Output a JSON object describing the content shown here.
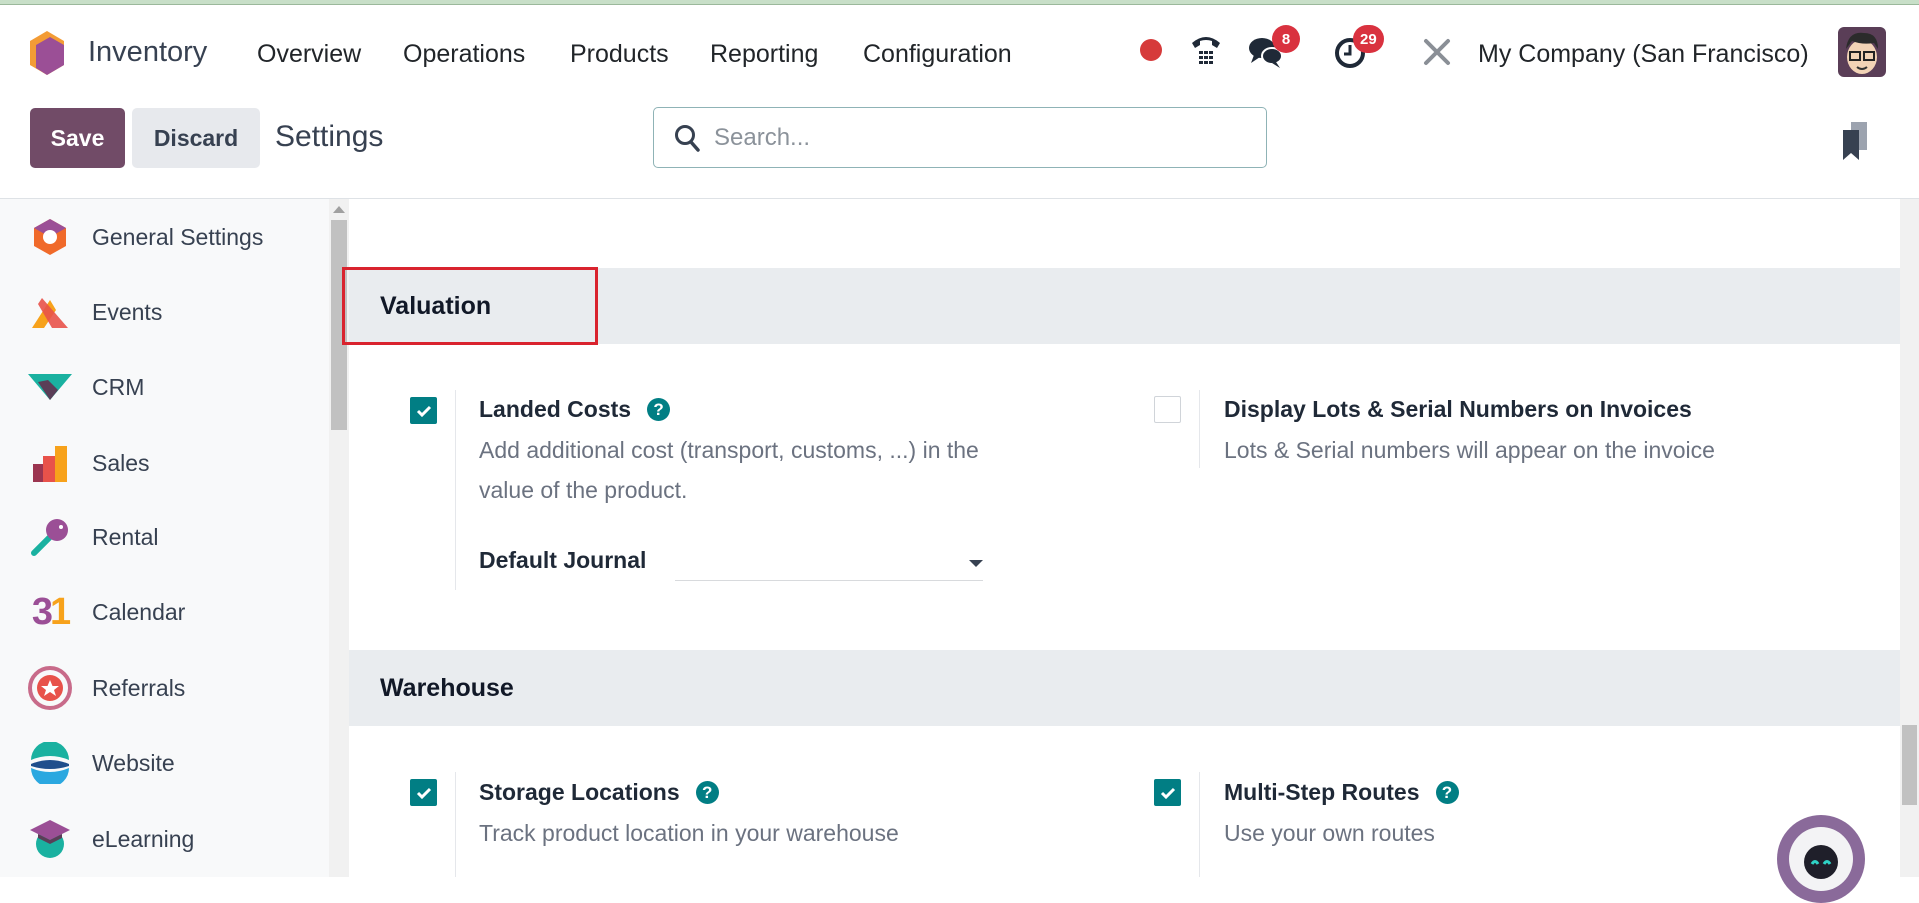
{
  "navbar": {
    "app_name": "Inventory",
    "menu": [
      "Overview",
      "Operations",
      "Products",
      "Reporting",
      "Configuration"
    ],
    "messages_count": "8",
    "activities_count": "29",
    "company": "My Company (San Francisco)"
  },
  "control": {
    "save_label": "Save",
    "discard_label": "Discard",
    "title": "Settings",
    "search_placeholder": "Search..."
  },
  "sidebar": {
    "items": [
      {
        "label": "General Settings",
        "icon": "general-settings-icon"
      },
      {
        "label": "Events",
        "icon": "events-icon"
      },
      {
        "label": "CRM",
        "icon": "crm-icon"
      },
      {
        "label": "Sales",
        "icon": "sales-icon"
      },
      {
        "label": "Rental",
        "icon": "rental-icon"
      },
      {
        "label": "Calendar",
        "icon": "calendar-icon",
        "glyph": "31"
      },
      {
        "label": "Referrals",
        "icon": "referrals-icon"
      },
      {
        "label": "Website",
        "icon": "website-icon"
      },
      {
        "label": "eLearning",
        "icon": "elearning-icon"
      }
    ]
  },
  "sections": {
    "valuation": {
      "title": "Valuation",
      "landed_costs": {
        "title": "Landed Costs",
        "checked": true,
        "desc1": "Add additional cost (transport, customs, ...) in the",
        "desc2": "value of the product.",
        "journal_label": "Default Journal",
        "journal_value": ""
      },
      "lots_invoices": {
        "title": "Display Lots & Serial Numbers on Invoices",
        "checked": false,
        "desc": "Lots & Serial numbers will appear on the invoice"
      }
    },
    "warehouse": {
      "title": "Warehouse",
      "storage": {
        "title": "Storage Locations",
        "checked": true,
        "desc": "Track product location in your warehouse"
      },
      "routes": {
        "title": "Multi-Step Routes",
        "checked": true,
        "desc": "Use your own routes"
      }
    }
  },
  "colors": {
    "primary": "#714b67",
    "accent": "#017e84",
    "highlight": "#d9232e"
  }
}
